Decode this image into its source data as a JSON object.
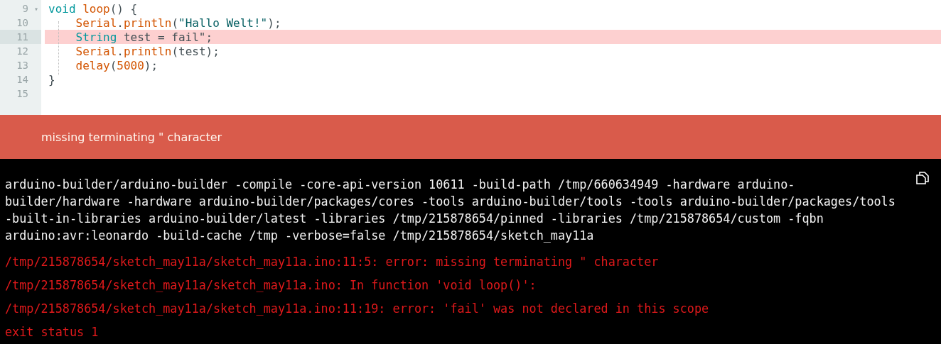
{
  "editor": {
    "lines": [
      {
        "number": "9",
        "fold": "▾",
        "error": false,
        "indented": false,
        "tokens": [
          {
            "kind": "keyword",
            "text": "void"
          },
          {
            "kind": "function",
            "text": "loop",
            "gap_before": true
          },
          {
            "kind": "plain",
            "text": "() {"
          }
        ]
      },
      {
        "number": "10",
        "error": false,
        "indented": true,
        "tokens": [
          {
            "kind": "function",
            "text": "Serial"
          },
          {
            "kind": "plain",
            "text": "."
          },
          {
            "kind": "function",
            "text": "println"
          },
          {
            "kind": "plain",
            "text": "("
          },
          {
            "kind": "string",
            "text": "\"Hallo Welt!\""
          },
          {
            "kind": "plain",
            "text": ");"
          }
        ]
      },
      {
        "number": "11",
        "error": true,
        "indented": true,
        "tokens": [
          {
            "kind": "keyword",
            "text": "String"
          },
          {
            "kind": "plain",
            "text": "test = fail\";",
            "gap_before": true
          }
        ]
      },
      {
        "number": "12",
        "error": false,
        "indented": true,
        "tokens": [
          {
            "kind": "function",
            "text": "Serial"
          },
          {
            "kind": "plain",
            "text": "."
          },
          {
            "kind": "function",
            "text": "println"
          },
          {
            "kind": "plain",
            "text": "(test);"
          }
        ]
      },
      {
        "number": "13",
        "error": false,
        "indented": true,
        "tokens": [
          {
            "kind": "function",
            "text": "delay"
          },
          {
            "kind": "plain",
            "text": "("
          },
          {
            "kind": "number",
            "text": "5000"
          },
          {
            "kind": "plain",
            "text": ");"
          }
        ]
      },
      {
        "number": "14",
        "error": false,
        "indented": false,
        "tokens": [
          {
            "kind": "plain",
            "text": "}"
          }
        ]
      },
      {
        "number": "15",
        "error": false
      }
    ]
  },
  "error_banner": {
    "message": "missing terminating \" character"
  },
  "console": {
    "command_lines": [
      "arduino-builder/arduino-builder -compile -core-api-version 10611 -build-path /tmp/660634949 -hardware arduino-",
      "builder/hardware -hardware arduino-builder/packages/cores -tools arduino-builder/tools -tools arduino-builder/packages/tools",
      "-built-in-libraries arduino-builder/latest -libraries /tmp/215878654/pinned -libraries /tmp/215878654/custom -fqbn",
      "arduino:avr:leonardo -build-cache /tmp -verbose=false /tmp/215878654/sketch_may11a"
    ],
    "errors": [
      "/tmp/215878654/sketch_may11a/sketch_may11a.ino:11:5: error: missing terminating \" character",
      "/tmp/215878654/sketch_may11a/sketch_may11a.ino: In function 'void loop()':",
      "/tmp/215878654/sketch_may11a/sketch_may11a.ino:11:19: error: 'fail' was not declared in this scope",
      "exit status 1"
    ]
  }
}
